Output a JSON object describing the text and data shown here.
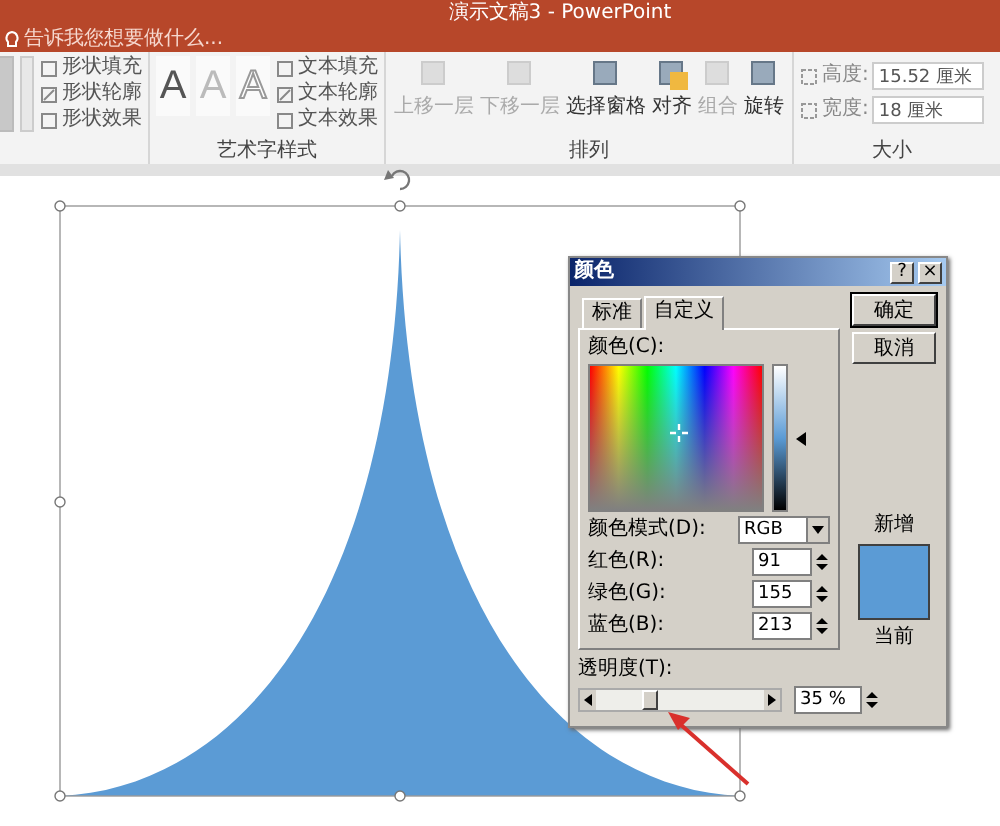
{
  "window": {
    "title": "演示文稿3 - PowerPoint"
  },
  "tell_me": {
    "placeholder": "告诉我您想要做什么..."
  },
  "ribbon": {
    "shape_styles": {
      "items": [
        {
          "label": "形状填充"
        },
        {
          "label": "形状轮廓"
        },
        {
          "label": "形状效果"
        }
      ]
    },
    "wordart_styles": {
      "label": "艺术字样式",
      "samples": [
        {
          "text": "A",
          "kind": "filled"
        },
        {
          "text": "A",
          "kind": "light"
        },
        {
          "text": "A",
          "kind": "outline"
        }
      ],
      "items": [
        {
          "label": "文本填充"
        },
        {
          "label": "文本轮廓"
        },
        {
          "label": "文本效果"
        }
      ]
    },
    "arrange": {
      "label": "排列",
      "buttons": [
        {
          "label": "上移一层",
          "disabled": true
        },
        {
          "label": "下移一层",
          "disabled": true
        },
        {
          "label": "选择窗格",
          "disabled": false
        },
        {
          "label": "对齐",
          "disabled": false
        },
        {
          "label": "组合",
          "disabled": true
        },
        {
          "label": "旋转",
          "disabled": false
        }
      ]
    },
    "size": {
      "label": "大小",
      "fields": [
        {
          "label": "高度:",
          "value": "15.52 厘米"
        },
        {
          "label": "宽度:",
          "value": "18 厘米"
        }
      ]
    }
  },
  "color_dialog": {
    "title": "颜色",
    "help": "?",
    "close": "×",
    "tabs": [
      {
        "label": "标准",
        "selected": false
      },
      {
        "label": "自定义",
        "selected": true
      }
    ],
    "colors_label": "颜色(C):",
    "mode": {
      "label": "颜色模式(D):",
      "value": "RGB"
    },
    "channels": [
      {
        "label": "红色(R):",
        "value": "91"
      },
      {
        "label": "绿色(G):",
        "value": "155"
      },
      {
        "label": "蓝色(B):",
        "value": "213"
      }
    ],
    "transparency": {
      "label": "透明度(T):",
      "level": 0.35,
      "value": "35 %"
    },
    "buttons": [
      "确定",
      "取消"
    ],
    "new_label": "新增",
    "current_label": "当前"
  }
}
